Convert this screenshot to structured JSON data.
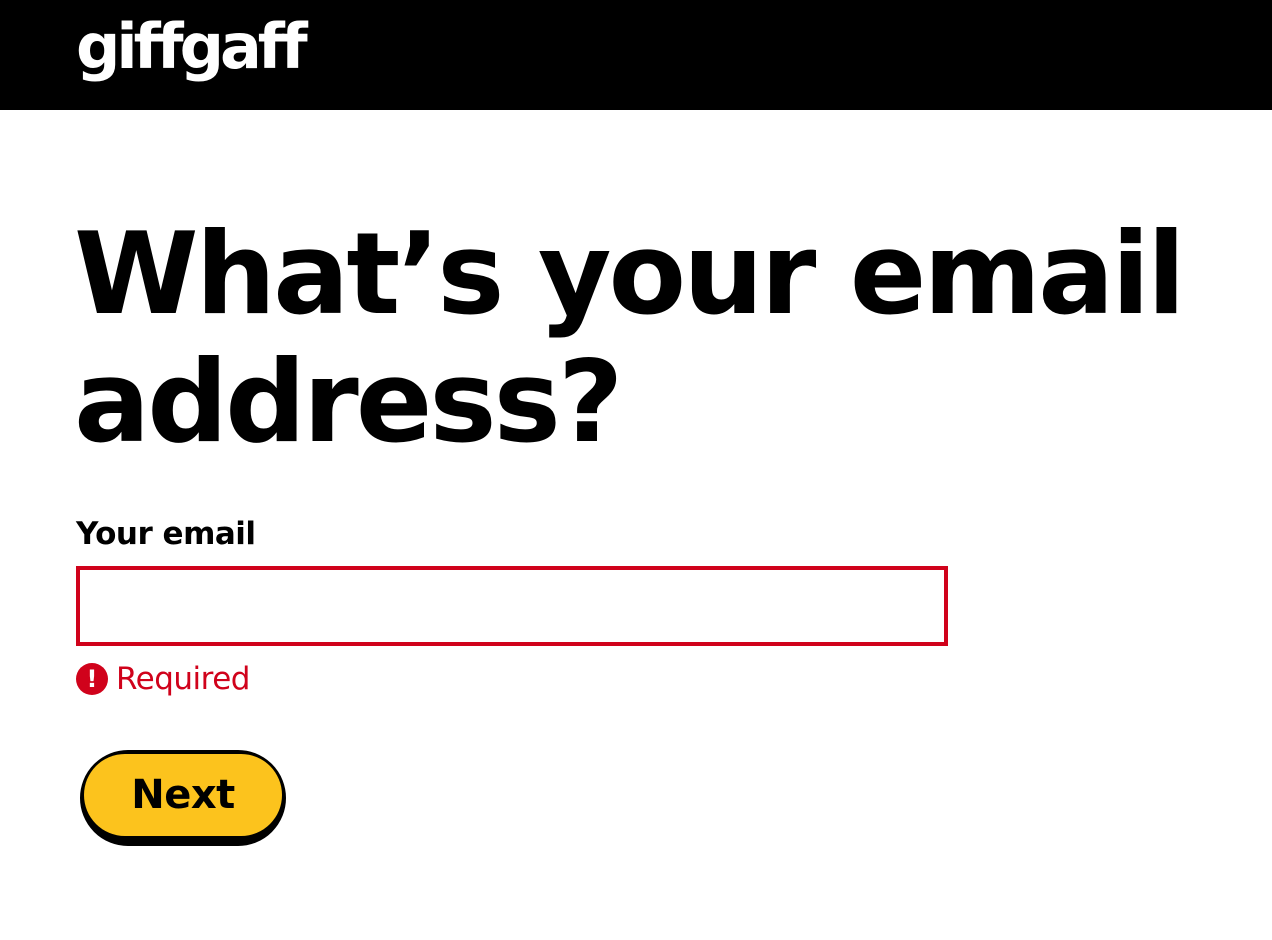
{
  "header": {
    "logo_text": "giffgaff",
    "background_color": "#000000"
  },
  "main": {
    "heading": "What’s your email address?",
    "email_label": "Your email",
    "email_value": "",
    "email_placeholder": "",
    "error": {
      "icon": "exclamation-icon",
      "icon_glyph": "!",
      "message": "Required",
      "color": "#d0021b"
    },
    "next_button_label": "Next",
    "accent_color": "#fcc31d"
  }
}
